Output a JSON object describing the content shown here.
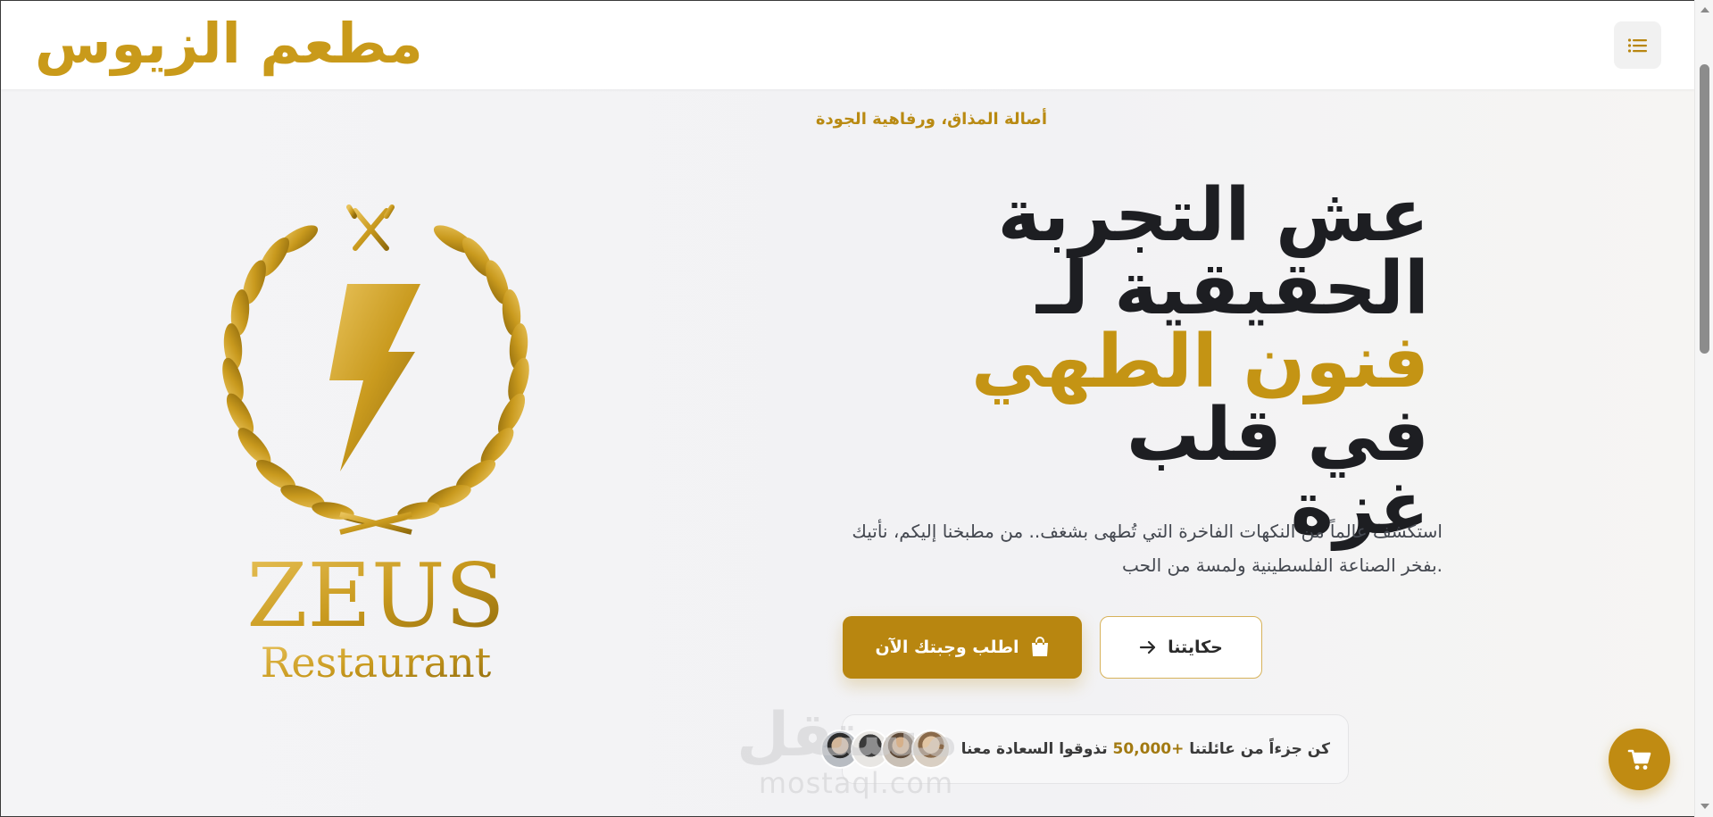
{
  "header": {
    "brand": "مطعم الزيوس",
    "menu_icon": "list-icon"
  },
  "logo": {
    "wordmark": "ZEUS",
    "subtitle": "Restaurant",
    "icons": [
      "fork-knife-icon",
      "lightning-icon",
      "laurel-wreath-icon"
    ]
  },
  "hero": {
    "tagline": "أصالة المذاق، ورفاهية الجودة",
    "headline_line1": "عش التجربة",
    "headline_line2": "الحقيقية لـ",
    "headline_gold": "فنون الطهي",
    "headline_line3_rest": "في قلب",
    "headline_line4": "غزة",
    "description_line1": "استكشف عالماً من النكهات الفاخرة التي تُطهى بشغف.. من مطبخنا إليكم، نأتيك",
    "description_line2": ".بفخر الصناعة الفلسطينية ولمسة من الحب",
    "primary_button": "اطلب وجبتك الآن",
    "primary_icon": "shopping-bag-icon",
    "secondary_button": "حكايتنا",
    "secondary_icon": "arrow-right-icon"
  },
  "social_proof": {
    "text_before": "كن جزءاً من عائلتنا",
    "count": "+50,000",
    "text_after": "تذوقوا السعادة معنا",
    "avatar_count": 4
  },
  "watermark": {
    "arabic": "مستقل",
    "latin": "mostaql.com"
  },
  "floating": {
    "cart_icon": "cart-icon"
  },
  "colors": {
    "gold": "#c49414",
    "dark_gold": "#b88610",
    "text_dark": "#1d1e22",
    "background": "#f2f2f4"
  }
}
